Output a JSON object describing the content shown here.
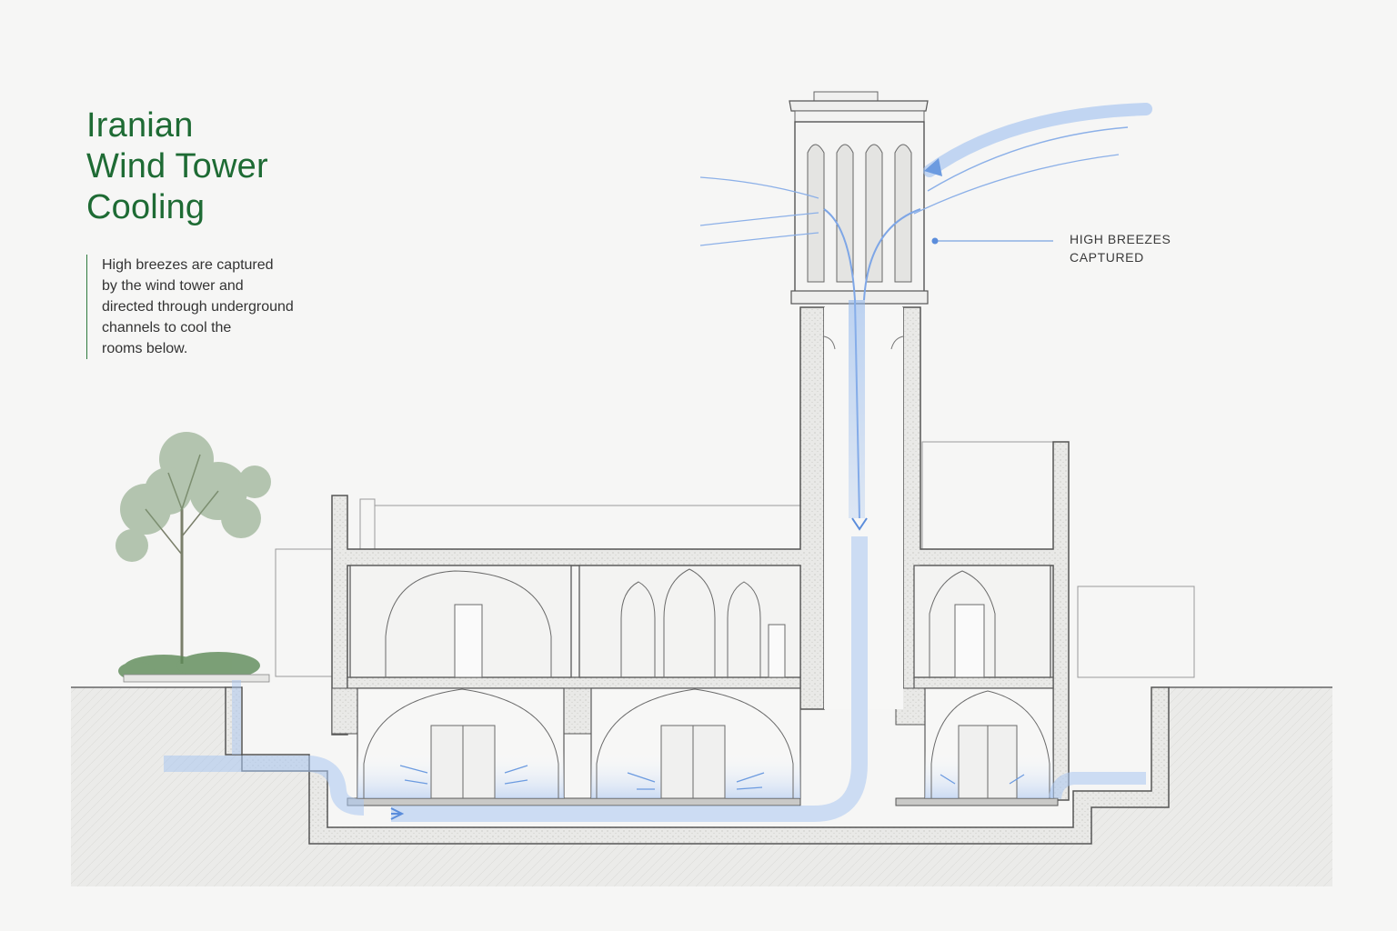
{
  "title": {
    "line1": "Iranian",
    "line2": "Wind Tower",
    "line3": "Cooling"
  },
  "description": {
    "lines": [
      "High breezes are captured",
      "by the wind tower and",
      "directed through underground",
      "channels to cool the",
      "rooms below."
    ]
  },
  "callout": {
    "line1": "HIGH BREEZES",
    "line2": "CAPTURED"
  },
  "colors": {
    "title_green": "#1e6b34",
    "airflow_blue": "#6c9be0",
    "wall": "#555555",
    "ground": "#e8e8e6"
  }
}
